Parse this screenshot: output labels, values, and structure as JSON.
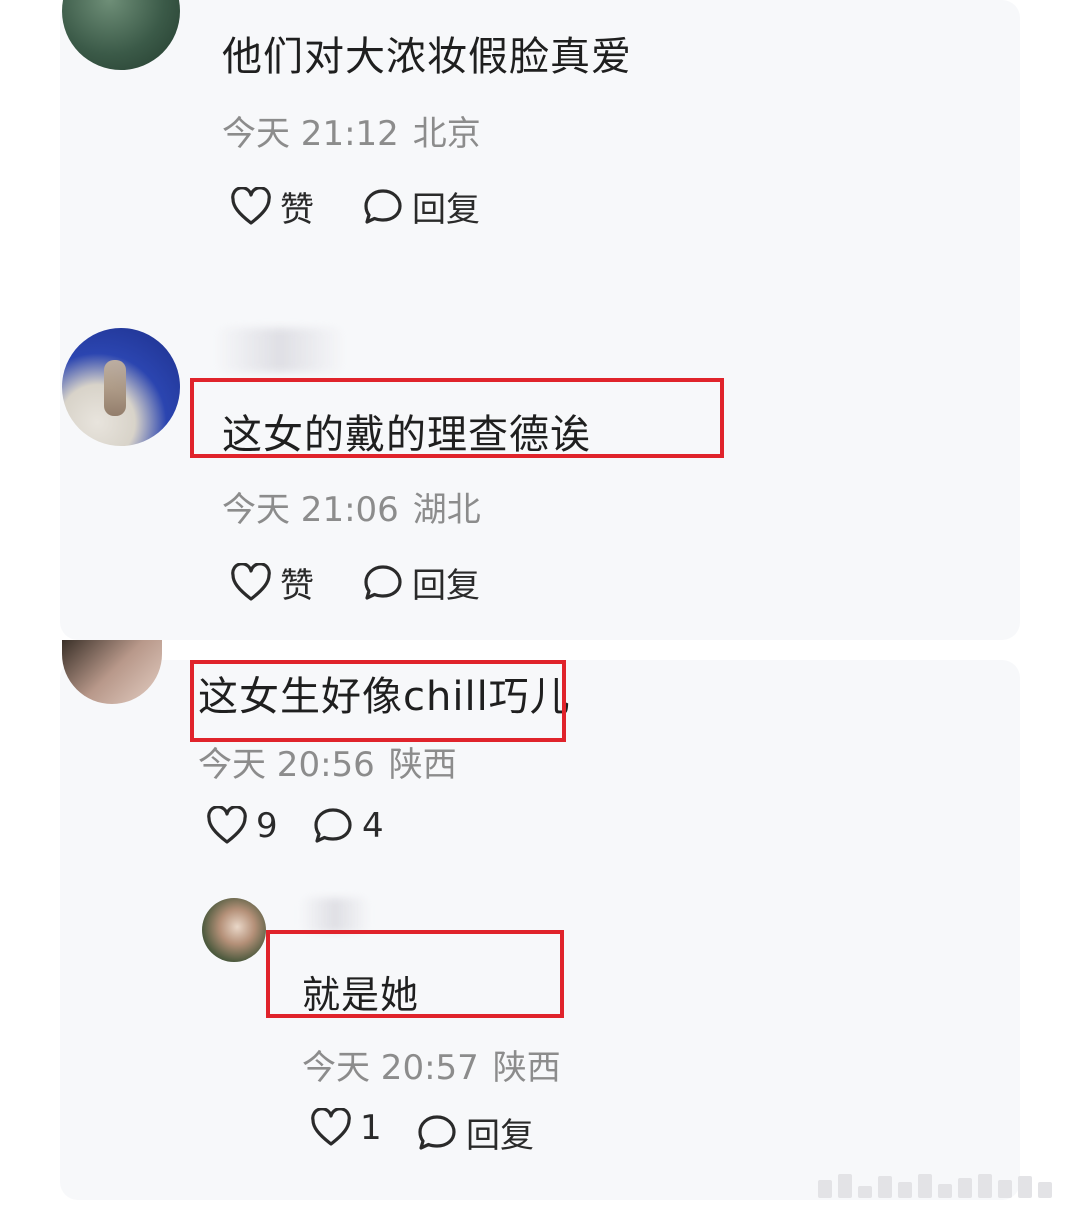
{
  "comments": [
    {
      "text": "他们对大浓妆假脸真爱",
      "time": "今天 21:12",
      "location": "北京",
      "like_label": "赞",
      "reply_label": "回复"
    },
    {
      "text": "这女的戴的理查德诶",
      "time": "今天 21:06",
      "location": "湖北",
      "like_label": "赞",
      "reply_label": "回复"
    },
    {
      "text": "这女生好像chill巧儿",
      "time": "今天 20:56",
      "location": "陕西",
      "like_label": "9",
      "reply_label": "4"
    }
  ],
  "reply": {
    "text": "就是她",
    "time": "今天 20:57",
    "location": "陕西",
    "like_label": "1",
    "reply_label": "回复"
  },
  "colors": {
    "highlight": "#e0232b",
    "card_bg": "#f7f8fa",
    "meta_text": "#8c8c8c"
  },
  "icons": [
    "heart-icon",
    "comment-bubble-icon"
  ]
}
